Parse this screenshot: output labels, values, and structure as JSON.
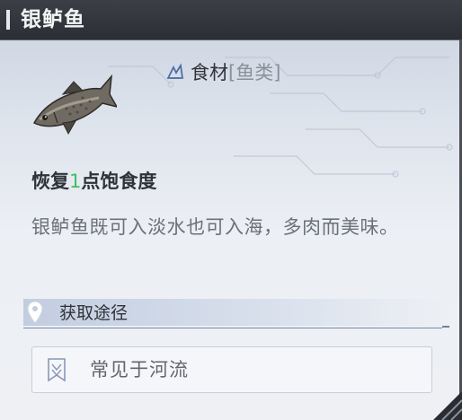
{
  "item": {
    "name": "银鲈鱼",
    "category_main": "食材",
    "category_sub": "[鱼类]",
    "icon": "fish-image"
  },
  "effect": {
    "prefix": "恢复",
    "amount": "1",
    "suffix": "点饱食度"
  },
  "description": "银鲈鱼既可入淡水也可入海，多肉而美味。",
  "source": {
    "header": "获取途径",
    "items": [
      {
        "label": "常见于河流",
        "icon": "river-icon"
      }
    ]
  },
  "colors": {
    "title_bg": "#2b2e34",
    "effect_amount": "#3fbf63",
    "panel_bg": "#eceff4"
  }
}
